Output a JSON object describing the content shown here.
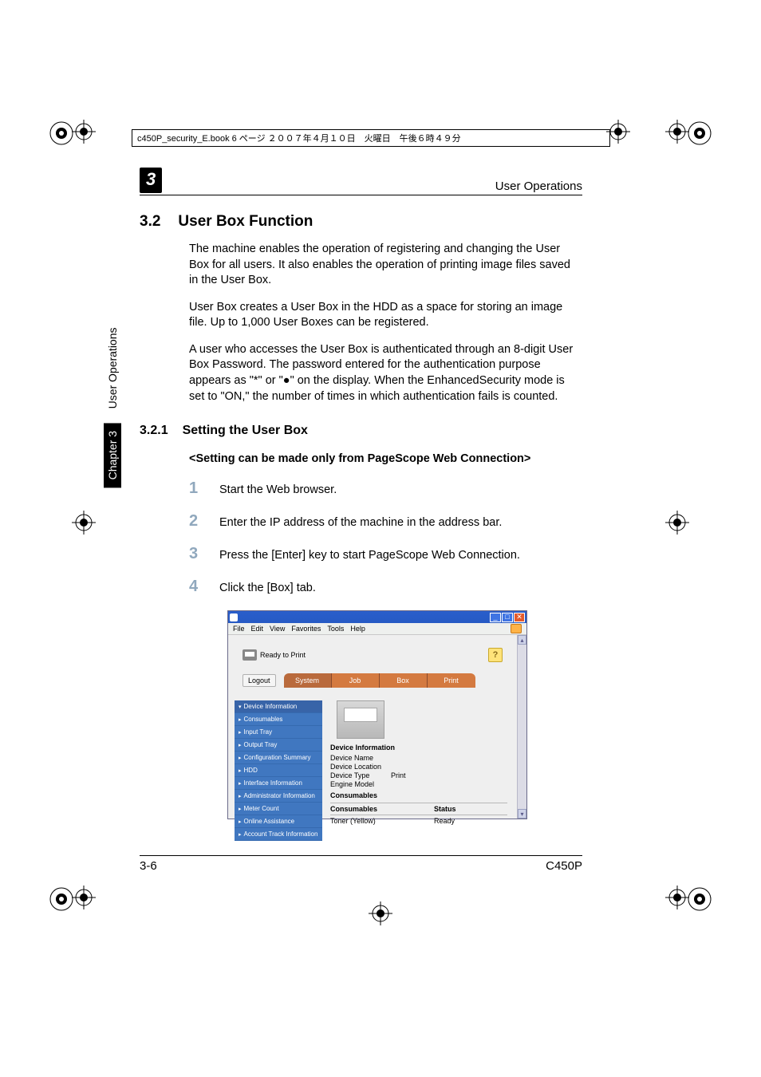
{
  "book_header": "c450P_security_E.book  6 ページ   ２００７年４月１０日　火曜日　午後６時４９分",
  "running_head": {
    "chapter_badge": "3",
    "right": "User Operations"
  },
  "section": {
    "number": "3.2",
    "title": "User Box Function"
  },
  "paragraphs": {
    "p1": "The machine enables the operation of registering and changing the User Box for all users. It also enables the operation of printing image files saved in the User Box.",
    "p2": "User Box creates a User Box in the HDD as a space for storing an image file. Up to 1,000 User Boxes can be registered.",
    "p3": "A user who accesses the User Box is authenticated through an 8-digit User Box Password. The password entered for the authentication purpose appears as \"*\" or \"●\" on the display. When the EnhancedSecurity mode is set to \"ON,\" the number of times in which authentication fails is counted."
  },
  "subsection": {
    "number": "3.2.1",
    "title": "Setting the User Box"
  },
  "instruction_title": "<Setting can be made only from PageScope Web Connection>",
  "steps": {
    "s1_num": "1",
    "s1": "Start the Web browser.",
    "s2_num": "2",
    "s2": "Enter the IP address of the machine in the address bar.",
    "s3_num": "3",
    "s3": "Press the [Enter] key to start PageScope Web Connection.",
    "s4_num": "4",
    "s4": "Click the [Box] tab."
  },
  "screenshot": {
    "menus": {
      "file": "File",
      "edit": "Edit",
      "view": "View",
      "fav": "Favorites",
      "tools": "Tools",
      "help": "Help"
    },
    "status_text": "Ready to Print",
    "help_icon": "?",
    "logout": "Logout",
    "tabs": {
      "system": "System",
      "job": "Job",
      "box": "Box",
      "print": "Print"
    },
    "sidebar": {
      "device_info": "Device Information",
      "consumables": "Consumables",
      "input_tray": "Input Tray",
      "output_tray": "Output Tray",
      "config_summary": "Configuration Summary",
      "hdd": "HDD",
      "interface_info": "Interface Information",
      "admin_info": "Administrator Information",
      "meter_count": "Meter Count",
      "online_assist": "Online Assistance",
      "acct_track": "Account Track Information"
    },
    "main": {
      "device_info_head": "Device Information",
      "device_name": "Device Name",
      "device_location": "Device Location",
      "device_type": "Device Type",
      "device_type_val": "Print",
      "engine_model": "Engine Model",
      "consumables_head": "Consumables",
      "col_consumables": "Consumables",
      "col_status": "Status",
      "row_toner": "Toner (Yellow)",
      "row_toner_status": "Ready"
    }
  },
  "side_tab": {
    "chapter": "Chapter 3",
    "section": "User Operations"
  },
  "footer": {
    "left": "3-6",
    "right": "C450P"
  }
}
